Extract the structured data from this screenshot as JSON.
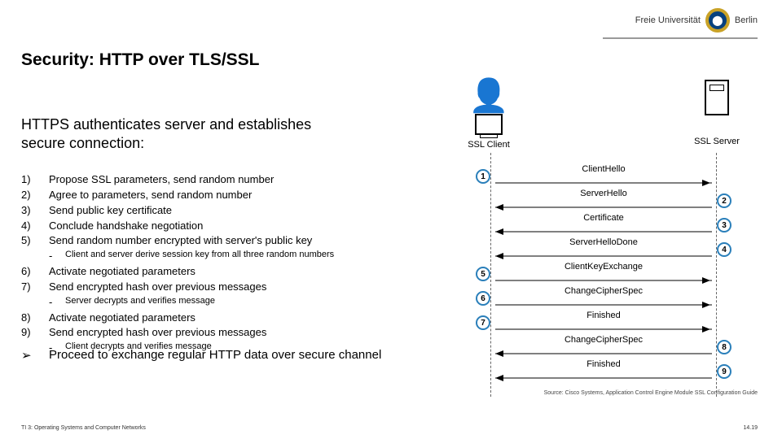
{
  "header": {
    "uni_prefix": "Freie Universität",
    "uni_city": "Berlin"
  },
  "title": "Security: HTTP over TLS/SSL",
  "subheading": "HTTPS authenticates server and establishes secure connection:",
  "steps": {
    "s1n": "1)",
    "s1": "Propose SSL parameters, send random number",
    "s2n": "2)",
    "s2": "Agree to parameters, send random number",
    "s3n": "3)",
    "s3": "Send public key certificate",
    "s4n": "4)",
    "s4": "Conclude handshake negotiation",
    "s5n": "5)",
    "s5": "Send random number encrypted with server's public key",
    "sub1": "Client and server derive session key from all three random numbers",
    "s6n": "6)",
    "s6": "Activate negotiated parameters",
    "s7n": "7)",
    "s7": "Send encrypted hash over previous messages",
    "sub2": "Server decrypts and verifies message",
    "s8n": "8)",
    "s8": "Activate negotiated parameters",
    "s9n": "9)",
    "s9": "Send encrypted hash over previous messages",
    "sub3": "Client decrypts and verifies message",
    "dash": "-"
  },
  "final": {
    "arrow": "➢",
    "text": "Proceed to exchange regular HTTP data over secure channel"
  },
  "diagram": {
    "client_label": "SSL Client",
    "server_label": "SSL Server",
    "m1": "ClientHello",
    "m2": "ServerHello",
    "m3": "Certificate",
    "m4": "ServerHelloDone",
    "m5": "ClientKeyExchange",
    "m6": "ChangeCipherSpec",
    "m7": "Finished",
    "m8": "ChangeCipherSpec",
    "m9": "Finished",
    "n1": "1",
    "n2": "2",
    "n3": "3",
    "n4": "4",
    "n5": "5",
    "n6": "6",
    "n7": "7",
    "n8": "8",
    "n9": "9"
  },
  "source": "Source: Cisco Systems, Application Control Engine Module SSL Configuration Guide",
  "footer": {
    "left": "TI 3: Operating Systems and Computer Networks",
    "right": "14.19"
  }
}
